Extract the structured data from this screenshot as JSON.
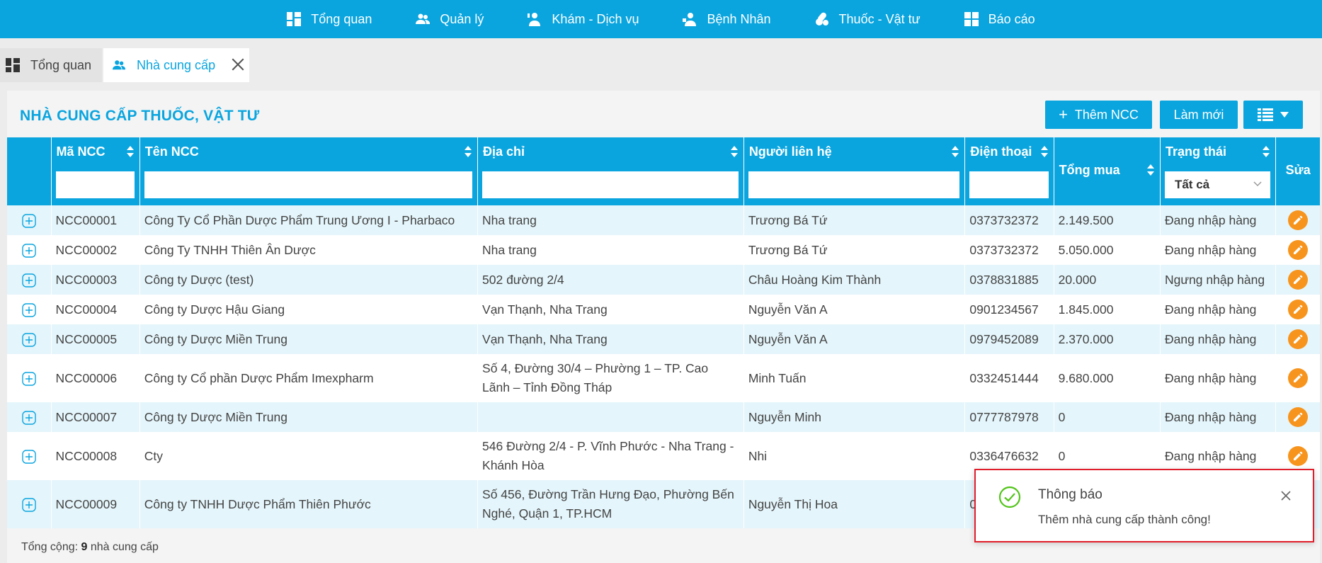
{
  "nav": {
    "items": [
      {
        "label": "Tổng quan",
        "icon": "dashboard-icon"
      },
      {
        "label": "Quản lý",
        "icon": "users-icon"
      },
      {
        "label": "Khám - Dịch vụ",
        "icon": "doctor-icon"
      },
      {
        "label": "Bệnh Nhân",
        "icon": "patient-icon"
      },
      {
        "label": "Thuốc - Vật tư",
        "icon": "pills-icon"
      },
      {
        "label": "Báo cáo",
        "icon": "report-icon"
      }
    ]
  },
  "tabs": [
    {
      "label": "Tổng quan",
      "icon": "dashboard-icon",
      "active": false
    },
    {
      "label": "Nhà cung cấp",
      "icon": "users-icon",
      "active": true
    }
  ],
  "panel": {
    "title": "NHÀ CUNG CẤP THUỐC, VẬT TƯ",
    "add_button": "Thêm NCC",
    "add_icon": "+",
    "refresh_button": "Làm mới"
  },
  "table": {
    "headers": {
      "code": "Mã NCC",
      "name": "Tên NCC",
      "address": "Địa chỉ",
      "contact": "Người liên hệ",
      "phone": "Điện thoại",
      "total": "Tổng mua",
      "status": "Trạng thái",
      "edit": "Sửa"
    },
    "status_filter": "Tất cả",
    "rows": [
      {
        "code": "NCC00001",
        "name": "Công Ty Cổ Phần Dược Phẩm Trung Ương I - Pharbaco",
        "address": "Nha trang",
        "contact": "Trương Bá Tứ",
        "phone": "0373732372",
        "total": "2.149.500",
        "status": "Đang nhập hàng"
      },
      {
        "code": "NCC00002",
        "name": "Công Ty TNHH Thiên Ân Dược",
        "address": "Nha trang",
        "contact": "Trương Bá Tứ",
        "phone": "0373732372",
        "total": "5.050.000",
        "status": "Đang nhập hàng"
      },
      {
        "code": "NCC00003",
        "name": "Công ty Dược (test)",
        "address": "502 đường 2/4",
        "contact": "Châu Hoàng Kim Thành",
        "phone": "0378831885",
        "total": "20.000",
        "status": "Ngưng nhập hàng"
      },
      {
        "code": "NCC00004",
        "name": "Công ty Dược Hậu Giang",
        "address": "Vạn Thạnh, Nha Trang",
        "contact": "Nguyễn Văn A",
        "phone": "0901234567",
        "total": "1.845.000",
        "status": "Đang nhập hàng"
      },
      {
        "code": "NCC00005",
        "name": "Công ty Dược Miền Trung",
        "address": "Vạn Thạnh, Nha Trang",
        "contact": "Nguyễn Văn A",
        "phone": "0979452089",
        "total": "2.370.000",
        "status": "Đang nhập hàng"
      },
      {
        "code": "NCC00006",
        "name": "Công ty Cổ phần Dược Phẩm Imexpharm",
        "address": "Số 4, Đường 30/4 – Phường 1 – TP. Cao Lãnh – Tỉnh Đồng Tháp",
        "contact": "Minh Tuấn",
        "phone": "0332451444",
        "total": "9.680.000",
        "status": "Đang nhập hàng"
      },
      {
        "code": "NCC00007",
        "name": "Công ty Dược Miền Trung",
        "address": "",
        "contact": "Nguyễn Minh",
        "phone": "0777787978",
        "total": "0",
        "status": "Đang nhập hàng"
      },
      {
        "code": "NCC00008",
        "name": "Cty",
        "address": "546 Đường 2/4 - P. Vĩnh Phước - Nha Trang - Khánh Hòa",
        "contact": "Nhi",
        "phone": "0336476632",
        "total": "0",
        "status": "Đang nhập hàng"
      },
      {
        "code": "NCC00009",
        "name": "Công ty TNHH Dược Phẩm Thiên Phước",
        "address": "Số 456, Đường Trần Hưng Đạo, Phường Bến Nghé, Quận 1, TP.HCM",
        "contact": "Nguyễn Thị Hoa",
        "phone": "0",
        "total": "",
        "status": ""
      }
    ]
  },
  "footer": {
    "prefix": "Tổng cộng: ",
    "count": "9",
    "suffix": " nhà cung cấp"
  },
  "toast": {
    "title": "Thông báo",
    "message": "Thêm nhà cung cấp thành công!"
  },
  "colors": {
    "primary": "#0aa5df",
    "edit_button": "#f7941d",
    "row_alt": "#e4f5fb",
    "toast_border": "#e01e2b",
    "success": "#52c41a"
  }
}
